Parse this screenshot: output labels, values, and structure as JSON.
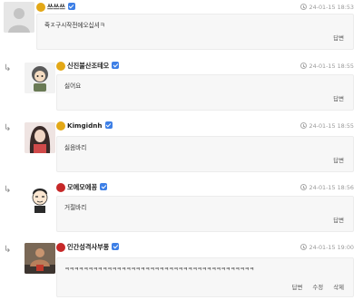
{
  "comments": [
    {
      "level_color": "#e3a817",
      "username": "쓰쓰쓰",
      "time": "24-01-15 18:53",
      "text": "죽ㅈ구시작전에오십셔ㅋ",
      "actions": [
        "답변"
      ]
    },
    {
      "level_color": "#e3a817",
      "username": "신진불산조테오",
      "time": "24-01-15 18:55",
      "text": "싫어요",
      "actions": [
        "답변"
      ]
    },
    {
      "level_color": "#e3a817",
      "username": "Kimgidnh",
      "time": "24-01-15 18:55",
      "text": "싫음바리",
      "actions": [
        "답변"
      ]
    },
    {
      "level_color": "#c62828",
      "username": "모에모에꽁",
      "time": "24-01-15 18:56",
      "text": "거절바리",
      "actions": [
        "답변"
      ]
    },
    {
      "level_color": "#c62828",
      "username": "인간성격사부풍",
      "time": "24-01-15 19:00",
      "text": "ㅋㅋㅋㅋㅋㅋㅋㅋㅋㅋㅋㅋㅋㅋㅋㅋㅋㅋㅋㅋㅋㅋㅋㅋㅋㅋㅋㅋㅋㅋㅋㅋㅋㅋㅋㅋㅋㅋㅋㅋ",
      "actions": [
        "답변",
        "수정",
        "삭제"
      ]
    }
  ],
  "icons": {
    "reply": "reply-arrow-icon",
    "verified": "verified-check-icon",
    "time": "clock-icon"
  }
}
